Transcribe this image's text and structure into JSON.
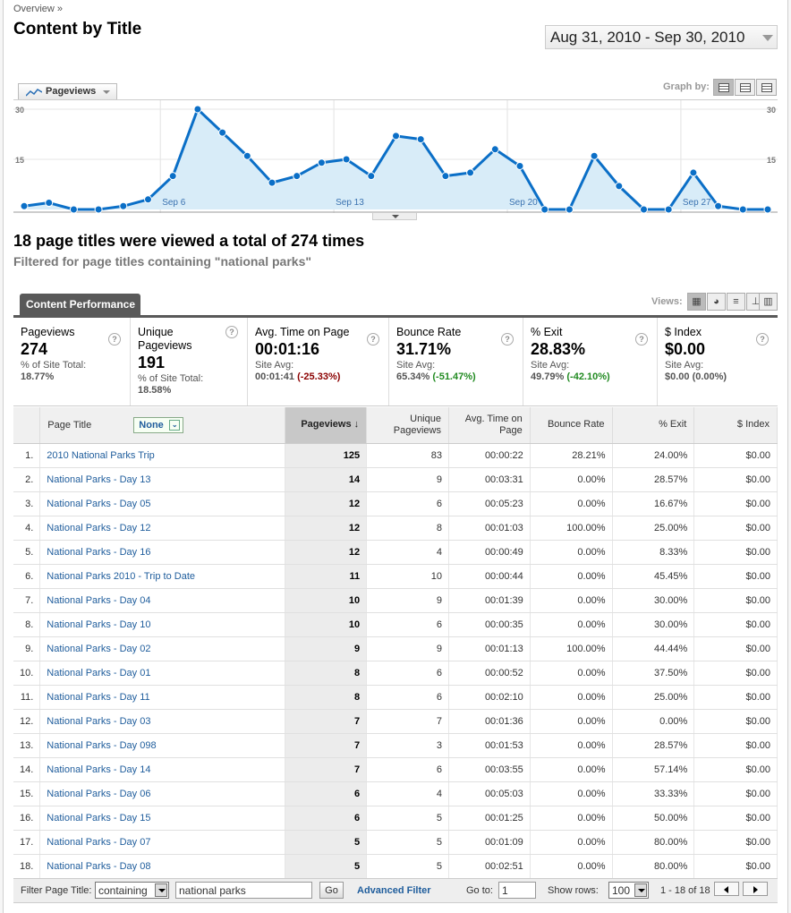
{
  "breadcrumb": "Overview »",
  "title": "Content by Title",
  "date_range": "Aug 31, 2010 - Sep 30, 2010",
  "graph": {
    "metric_label": "Pageviews",
    "graph_by_label": "Graph by:",
    "y_top": "30",
    "y_mid": "15"
  },
  "chart_data": {
    "type": "line",
    "x": [
      "Aug 31",
      "Sep 1",
      "Sep 2",
      "Sep 3",
      "Sep 4",
      "Sep 5",
      "Sep 6",
      "Sep 7",
      "Sep 8",
      "Sep 9",
      "Sep 10",
      "Sep 11",
      "Sep 12",
      "Sep 13",
      "Sep 14",
      "Sep 15",
      "Sep 16",
      "Sep 17",
      "Sep 18",
      "Sep 19",
      "Sep 20",
      "Sep 21",
      "Sep 22",
      "Sep 23",
      "Sep 24",
      "Sep 25",
      "Sep 26",
      "Sep 27",
      "Sep 28",
      "Sep 29",
      "Sep 30"
    ],
    "x_tick_labels": [
      "Sep 6",
      "Sep 13",
      "Sep 20",
      "Sep 27"
    ],
    "series": [
      {
        "name": "Pageviews",
        "values": [
          1,
          2,
          0,
          0,
          1,
          3,
          10,
          30,
          23,
          16,
          8,
          10,
          14,
          15,
          10,
          22,
          21,
          10,
          11,
          18,
          13,
          0,
          0,
          16,
          7,
          0,
          0,
          11,
          1,
          0,
          0
        ]
      }
    ],
    "ylim": [
      0,
      30
    ],
    "y_ticks": [
      15,
      30
    ],
    "grid": true
  },
  "summary": {
    "headline": "18 page titles were viewed a total of 274 times",
    "filter_note": "Filtered for page titles containing \"national parks\""
  },
  "tab_label": "Content Performance",
  "views_label": "Views:",
  "scorecards": [
    {
      "label": "Pageviews",
      "value": "274",
      "sub": "% of Site Total:",
      "subv": "18.77%",
      "delta": ""
    },
    {
      "label": "Unique Pageviews",
      "value": "191",
      "sub": "% of Site Total:",
      "subv": "18.58%",
      "delta": ""
    },
    {
      "label": "Avg. Time on Page",
      "value": "00:01:16",
      "sub": "Site Avg:",
      "subv": "00:01:41",
      "delta": "(-25.33%)"
    },
    {
      "label": "Bounce Rate",
      "value": "31.71%",
      "sub": "Site Avg:",
      "subv": "65.34%",
      "delta": "(-51.47%)"
    },
    {
      "label": "% Exit",
      "value": "28.83%",
      "sub": "Site Avg:",
      "subv": "49.79%",
      "delta": "(-42.10%)"
    },
    {
      "label": "$ Index",
      "value": "$0.00",
      "sub": "Site Avg:",
      "subv": "$0.00 (0.00%)",
      "delta": ""
    }
  ],
  "table": {
    "headers": {
      "page_title": "Page Title",
      "secondary": "None",
      "pageviews": "Pageviews",
      "unique": "Unique Pageviews",
      "avg_time": "Avg. Time on Page",
      "bounce": "Bounce Rate",
      "exit": "% Exit",
      "index": "$ Index"
    },
    "rows": [
      [
        "1.",
        "2010 National Parks Trip",
        "125",
        "83",
        "00:00:22",
        "28.21%",
        "24.00%",
        "$0.00"
      ],
      [
        "2.",
        "National Parks - Day 13",
        "14",
        "9",
        "00:03:31",
        "0.00%",
        "28.57%",
        "$0.00"
      ],
      [
        "3.",
        "National Parks - Day 05",
        "12",
        "6",
        "00:05:23",
        "0.00%",
        "16.67%",
        "$0.00"
      ],
      [
        "4.",
        "National Parks - Day 12",
        "12",
        "8",
        "00:01:03",
        "100.00%",
        "25.00%",
        "$0.00"
      ],
      [
        "5.",
        "National Parks - Day 16",
        "12",
        "4",
        "00:00:49",
        "0.00%",
        "8.33%",
        "$0.00"
      ],
      [
        "6.",
        "National Parks 2010 - Trip to Date",
        "11",
        "10",
        "00:00:44",
        "0.00%",
        "45.45%",
        "$0.00"
      ],
      [
        "7.",
        "National Parks - Day 04",
        "10",
        "9",
        "00:01:39",
        "0.00%",
        "30.00%",
        "$0.00"
      ],
      [
        "8.",
        "National Parks - Day 10",
        "10",
        "6",
        "00:00:35",
        "0.00%",
        "30.00%",
        "$0.00"
      ],
      [
        "9.",
        "National Parks - Day 02",
        "9",
        "9",
        "00:01:13",
        "100.00%",
        "44.44%",
        "$0.00"
      ],
      [
        "10.",
        "National Parks - Day 01",
        "8",
        "6",
        "00:00:52",
        "0.00%",
        "37.50%",
        "$0.00"
      ],
      [
        "11.",
        "National Parks - Day 11",
        "8",
        "6",
        "00:02:10",
        "0.00%",
        "25.00%",
        "$0.00"
      ],
      [
        "12.",
        "National Parks - Day 03",
        "7",
        "7",
        "00:01:36",
        "0.00%",
        "0.00%",
        "$0.00"
      ],
      [
        "13.",
        "National Parks - Day 098",
        "7",
        "3",
        "00:01:53",
        "0.00%",
        "28.57%",
        "$0.00"
      ],
      [
        "14.",
        "National Parks - Day 14",
        "7",
        "6",
        "00:03:55",
        "0.00%",
        "57.14%",
        "$0.00"
      ],
      [
        "15.",
        "National Parks - Day 06",
        "6",
        "4",
        "00:05:03",
        "0.00%",
        "33.33%",
        "$0.00"
      ],
      [
        "16.",
        "National Parks - Day 15",
        "6",
        "5",
        "00:01:25",
        "0.00%",
        "50.00%",
        "$0.00"
      ],
      [
        "17.",
        "National Parks - Day 07",
        "5",
        "5",
        "00:01:09",
        "0.00%",
        "80.00%",
        "$0.00"
      ],
      [
        "18.",
        "National Parks - Day 08",
        "5",
        "5",
        "00:02:51",
        "0.00%",
        "80.00%",
        "$0.00"
      ]
    ]
  },
  "footer": {
    "filter_label": "Filter Page Title:",
    "filter_mode": "containing",
    "filter_value": "national parks",
    "go_label": "Go",
    "advanced_label": "Advanced Filter",
    "goto_label": "Go to:",
    "goto_value": "1",
    "show_rows_label": "Show rows:",
    "show_rows_value": "100",
    "range_text": "1 - 18 of 18"
  },
  "colors": {
    "line": "#0b6fc7",
    "fill": "#d8ecf8",
    "link": "#1f5d9c",
    "neg": "#8b0000",
    "pos": "#228b22"
  }
}
